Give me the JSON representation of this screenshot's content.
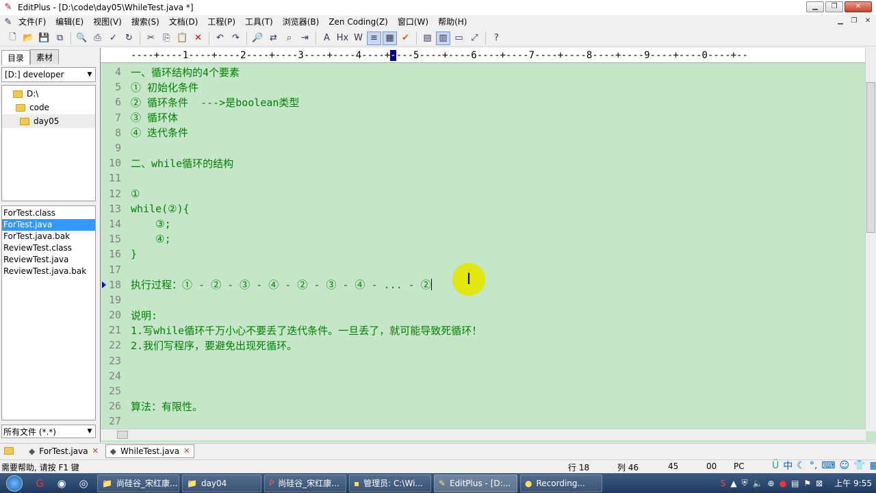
{
  "window": {
    "title": "EditPlus - [D:\\code\\day05\\WhileTest.java *]",
    "app_icon": "editplus-icon"
  },
  "menubar": [
    "文件(F)",
    "编辑(E)",
    "视图(V)",
    "搜索(S)",
    "文档(D)",
    "工程(P)",
    "工具(T)",
    "浏览器(B)",
    "Zen Coding(Z)",
    "窗口(W)",
    "帮助(H)"
  ],
  "sidebar": {
    "tabs": [
      "目录",
      "素材"
    ],
    "drive": "[D:] developer",
    "tree": [
      {
        "label": "D:\\",
        "indent": 0
      },
      {
        "label": "code",
        "indent": 1
      },
      {
        "label": "day05",
        "indent": 2,
        "selected": true
      }
    ],
    "files": [
      {
        "name": "ForTest.class",
        "selected": false
      },
      {
        "name": "ForTest.java",
        "selected": true
      },
      {
        "name": "ForTest.java.bak",
        "selected": false
      },
      {
        "name": "ReviewTest.class",
        "selected": false
      },
      {
        "name": "ReviewTest.java",
        "selected": false
      },
      {
        "name": "ReviewTest.java.bak",
        "selected": false
      }
    ],
    "filter": "所有文件 (*.*)"
  },
  "editor": {
    "ruler_before": "----+----1----+----2----+----3----+----4----+",
    "ruler_mark": "-",
    "ruler_after": "---5----+----6----+----7----+----8----+----9----+----0----+--",
    "lines": [
      {
        "n": "4",
        "text": "一、循环结构的4个要素"
      },
      {
        "n": "5",
        "text": "① 初始化条件"
      },
      {
        "n": "6",
        "text": "② 循环条件  --->是boolean类型"
      },
      {
        "n": "7",
        "text": "③ 循环体"
      },
      {
        "n": "8",
        "text": "④ 迭代条件"
      },
      {
        "n": "9",
        "text": ""
      },
      {
        "n": "10",
        "text": "二、while循环的结构"
      },
      {
        "n": "11",
        "text": ""
      },
      {
        "n": "12",
        "text": "①"
      },
      {
        "n": "13",
        "text": "while(②){"
      },
      {
        "n": "14",
        "text": "    ③;"
      },
      {
        "n": "15",
        "text": "    ④;"
      },
      {
        "n": "16",
        "text": "}"
      },
      {
        "n": "17",
        "text": ""
      },
      {
        "n": "18",
        "text": "执行过程：① - ② - ③ - ④ - ② - ③ - ④ - ... - ②",
        "current": true
      },
      {
        "n": "19",
        "text": ""
      },
      {
        "n": "20",
        "text": "说明:"
      },
      {
        "n": "21",
        "text": "1.写while循环千万小心不要丢了迭代条件。一旦丢了，就可能导致死循环！"
      },
      {
        "n": "22",
        "text": "2.我们写程序，要避免出现死循环。"
      },
      {
        "n": "23",
        "text": ""
      },
      {
        "n": "24",
        "text": ""
      },
      {
        "n": "25",
        "text": ""
      },
      {
        "n": "26",
        "text": "算法：有限性。"
      },
      {
        "n": "27",
        "text": ""
      }
    ]
  },
  "doc_tabs": [
    {
      "name": "ForTest.java",
      "active": false
    },
    {
      "name": "WhileTest.java",
      "active": true
    }
  ],
  "status": {
    "help": "需要帮助, 请按 F1 键",
    "row": "行 18",
    "col": "列 46",
    "num": "45",
    "code": "00",
    "mode": "PC"
  },
  "taskbar": {
    "tasks": [
      {
        "label": "尚硅谷_宋红康...",
        "icon": "folder-icon"
      },
      {
        "label": "day04",
        "icon": "folder-icon"
      },
      {
        "label": "尚硅谷_宋红康...",
        "icon": "powerpoint-icon"
      },
      {
        "label": "管理员: C:\\Wi...",
        "icon": "cmd-icon"
      },
      {
        "label": "EditPlus - [D:...",
        "icon": "editplus-icon",
        "active": true
      },
      {
        "label": "Recording...",
        "icon": "recording-icon"
      }
    ],
    "clock": "上午 9:55"
  },
  "colors": {
    "editor_bg": "#c6e6c9",
    "text_green": "#008000",
    "line_number_gray": "#808080",
    "selection_blue": "#3399ff",
    "mouse_halo": "#e5e600"
  }
}
